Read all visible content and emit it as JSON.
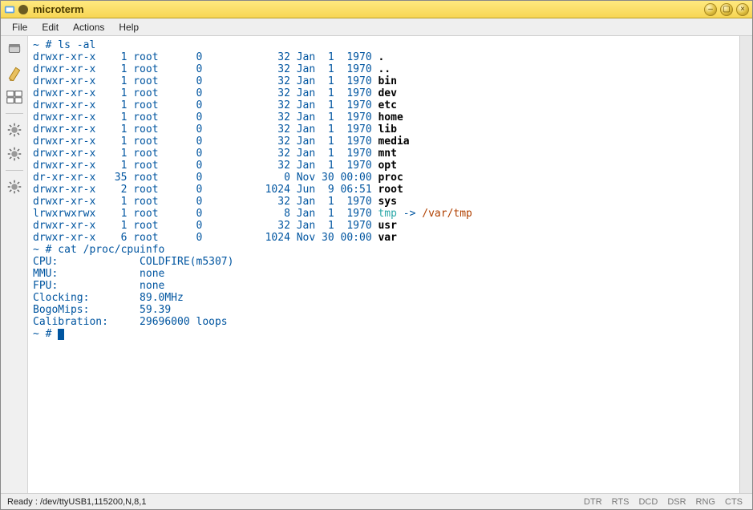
{
  "title": "microterm",
  "menus": [
    "File",
    "Edit",
    "Actions",
    "Help"
  ],
  "status_left": "Ready : /dev/ttyUSB1,115200,N,8,1",
  "status_right": [
    "DTR",
    "RTS",
    "DCD",
    "DSR",
    "RNG",
    "CTS"
  ],
  "term": {
    "cmd1": "~ # ls -al",
    "cmd2": "~ # cat /proc/cpuinfo",
    "prompt3": "~ # ",
    "ls": [
      {
        "perm": "drwxr-xr-x",
        "ln": "1",
        "own": "root",
        "sz": "0",
        "szf": "32",
        "date": "Jan  1  1970",
        "name": ".",
        "type": "dir"
      },
      {
        "perm": "drwxr-xr-x",
        "ln": "1",
        "own": "root",
        "sz": "0",
        "szf": "32",
        "date": "Jan  1  1970",
        "name": "..",
        "type": "dir"
      },
      {
        "perm": "drwxr-xr-x",
        "ln": "1",
        "own": "root",
        "sz": "0",
        "szf": "32",
        "date": "Jan  1  1970",
        "name": "bin",
        "type": "dir"
      },
      {
        "perm": "drwxr-xr-x",
        "ln": "1",
        "own": "root",
        "sz": "0",
        "szf": "32",
        "date": "Jan  1  1970",
        "name": "dev",
        "type": "dir"
      },
      {
        "perm": "drwxr-xr-x",
        "ln": "1",
        "own": "root",
        "sz": "0",
        "szf": "32",
        "date": "Jan  1  1970",
        "name": "etc",
        "type": "dir"
      },
      {
        "perm": "drwxr-xr-x",
        "ln": "1",
        "own": "root",
        "sz": "0",
        "szf": "32",
        "date": "Jan  1  1970",
        "name": "home",
        "type": "dir"
      },
      {
        "perm": "drwxr-xr-x",
        "ln": "1",
        "own": "root",
        "sz": "0",
        "szf": "32",
        "date": "Jan  1  1970",
        "name": "lib",
        "type": "dir"
      },
      {
        "perm": "drwxr-xr-x",
        "ln": "1",
        "own": "root",
        "sz": "0",
        "szf": "32",
        "date": "Jan  1  1970",
        "name": "media",
        "type": "dir"
      },
      {
        "perm": "drwxr-xr-x",
        "ln": "1",
        "own": "root",
        "sz": "0",
        "szf": "32",
        "date": "Jan  1  1970",
        "name": "mnt",
        "type": "dir"
      },
      {
        "perm": "drwxr-xr-x",
        "ln": "1",
        "own": "root",
        "sz": "0",
        "szf": "32",
        "date": "Jan  1  1970",
        "name": "opt",
        "type": "dir"
      },
      {
        "perm": "dr-xr-xr-x",
        "ln": "35",
        "own": "root",
        "sz": "0",
        "szf": "0",
        "date": "Nov 30 00:00",
        "name": "proc",
        "type": "dir"
      },
      {
        "perm": "drwxr-xr-x",
        "ln": "2",
        "own": "root",
        "sz": "0",
        "szf": "1024",
        "date": "Jun  9 06:51",
        "name": "root",
        "type": "dir"
      },
      {
        "perm": "drwxr-xr-x",
        "ln": "1",
        "own": "root",
        "sz": "0",
        "szf": "32",
        "date": "Jan  1  1970",
        "name": "sys",
        "type": "dir"
      },
      {
        "perm": "lrwxrwxrwx",
        "ln": "1",
        "own": "root",
        "sz": "0",
        "szf": "8",
        "date": "Jan  1  1970",
        "name": "tmp",
        "type": "link",
        "target": "/var/tmp"
      },
      {
        "perm": "drwxr-xr-x",
        "ln": "1",
        "own": "root",
        "sz": "0",
        "szf": "32",
        "date": "Jan  1  1970",
        "name": "usr",
        "type": "dir"
      },
      {
        "perm": "drwxr-xr-x",
        "ln": "6",
        "own": "root",
        "sz": "0",
        "szf": "1024",
        "date": "Nov 30 00:00",
        "name": "var",
        "type": "dir"
      }
    ],
    "cpuinfo": [
      {
        "k": "CPU:",
        "v": "COLDFIRE(m5307)"
      },
      {
        "k": "MMU:",
        "v": "none"
      },
      {
        "k": "FPU:",
        "v": "none"
      },
      {
        "k": "Clocking:",
        "v": "89.0MHz"
      },
      {
        "k": "BogoMips:",
        "v": "59.39"
      },
      {
        "k": "Calibration:",
        "v": "29696000 loops"
      }
    ]
  }
}
